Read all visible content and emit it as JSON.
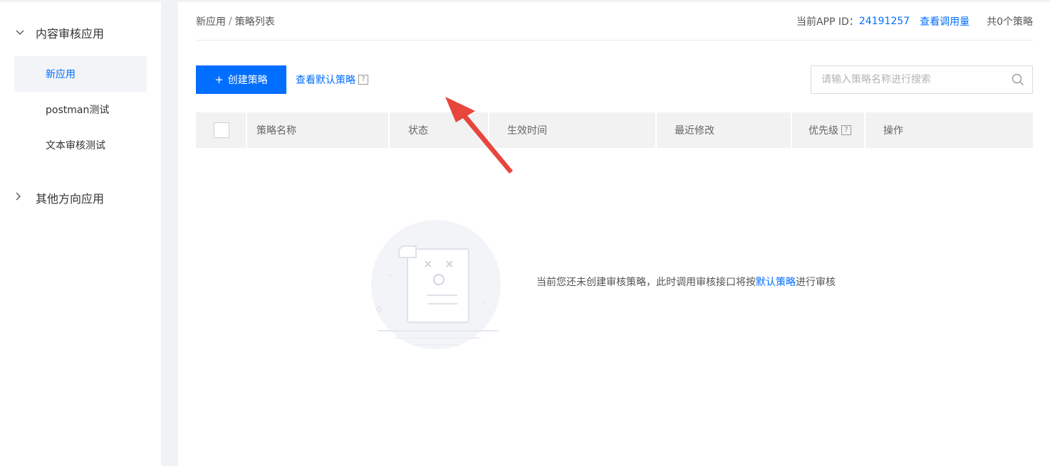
{
  "sidebar": {
    "groups": [
      {
        "label": "内容审核应用",
        "expanded": true,
        "items": [
          {
            "label": "新应用",
            "active": true
          },
          {
            "label": "postman测试",
            "active": false
          },
          {
            "label": "文本审核测试",
            "active": false
          }
        ]
      },
      {
        "label": "其他方向应用",
        "expanded": false,
        "items": []
      }
    ]
  },
  "header": {
    "breadcrumb": [
      "新应用",
      "策略列表"
    ],
    "breadcrumb_sep": "/",
    "app_id_label": "当前APP ID：",
    "app_id": "24191257",
    "usage_link": "查看调用量",
    "policy_count": "共0个策略"
  },
  "toolbar": {
    "create_button": "创建策略",
    "view_default": "查看默认策略",
    "search_placeholder": "请输入策略名称进行搜索"
  },
  "table": {
    "columns": [
      "策略名称",
      "状态",
      "生效时间",
      "最近修改",
      "优先级",
      "操作"
    ],
    "rows": []
  },
  "empty_state": {
    "text_before": "当前您还未创建审核策略，此时调用审核接口将按",
    "link": "默认策略",
    "text_after": "进行审核"
  },
  "colors": {
    "accent": "#006eff",
    "annotation": "#e8453c",
    "sidebar_active_bg": "#f3f4f7"
  }
}
